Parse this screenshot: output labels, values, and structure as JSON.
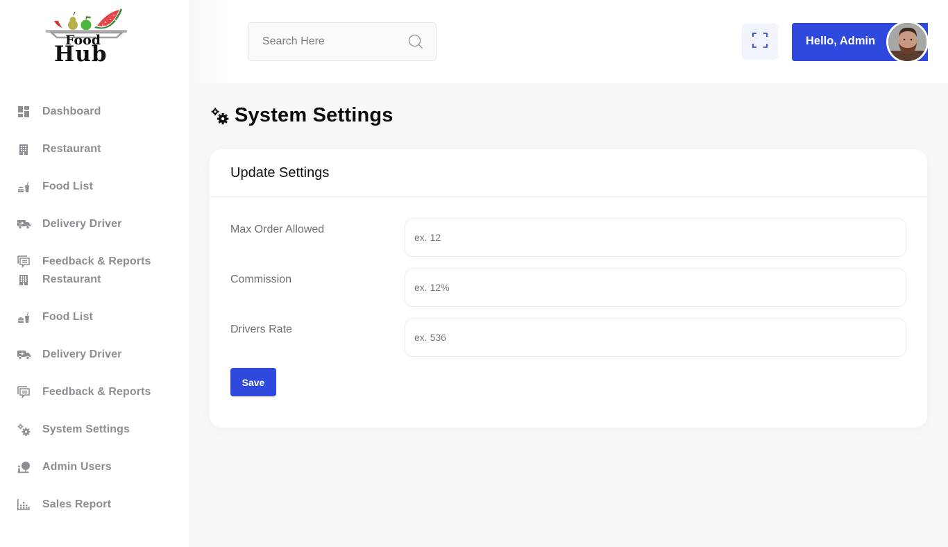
{
  "brand": {
    "logo_top": "Food",
    "logo_bottom": "Hub"
  },
  "sidebar": {
    "items": [
      {
        "label": "Dashboard",
        "icon": "dashboard-icon"
      },
      {
        "label": "Restaurant",
        "icon": "building-icon"
      },
      {
        "label": "Food List",
        "icon": "fastfood-icon"
      },
      {
        "label": "Delivery Driver",
        "icon": "truck-icon"
      },
      {
        "label": "Feedback & Reports",
        "icon": "feedback-icon"
      },
      {
        "label": "Restaurant",
        "icon": "building-icon"
      },
      {
        "label": "Food List",
        "icon": "fastfood-icon"
      },
      {
        "label": "Delivery Driver",
        "icon": "truck-icon"
      },
      {
        "label": "Feedback & Reports",
        "icon": "feedback-icon"
      },
      {
        "label": "System Settings",
        "icon": "settings-icon"
      },
      {
        "label": "Admin Users",
        "icon": "admin-users-icon"
      },
      {
        "label": "Sales Report",
        "icon": "bar-chart-icon"
      }
    ]
  },
  "header": {
    "search_placeholder": "Search Here",
    "greeting": "Hello, Admin",
    "fullscreen_icon": "fullscreen-icon",
    "avatar": "admin-avatar"
  },
  "main": {
    "page_title": "System Settings",
    "card_title": "Update Settings",
    "fields": [
      {
        "label": "Max Order Allowed",
        "placeholder": "ex. 12",
        "value": ""
      },
      {
        "label": "Commission",
        "placeholder": "ex. 12%",
        "value": ""
      },
      {
        "label": "Drivers Rate",
        "placeholder": "ex. 536",
        "value": ""
      }
    ],
    "save_label": "Save"
  },
  "colors": {
    "primary": "#2f49de",
    "sidebar_text": "#8b8e93",
    "background": "#f7f8f8",
    "fullscreen_bg": "#f1f4fc"
  }
}
